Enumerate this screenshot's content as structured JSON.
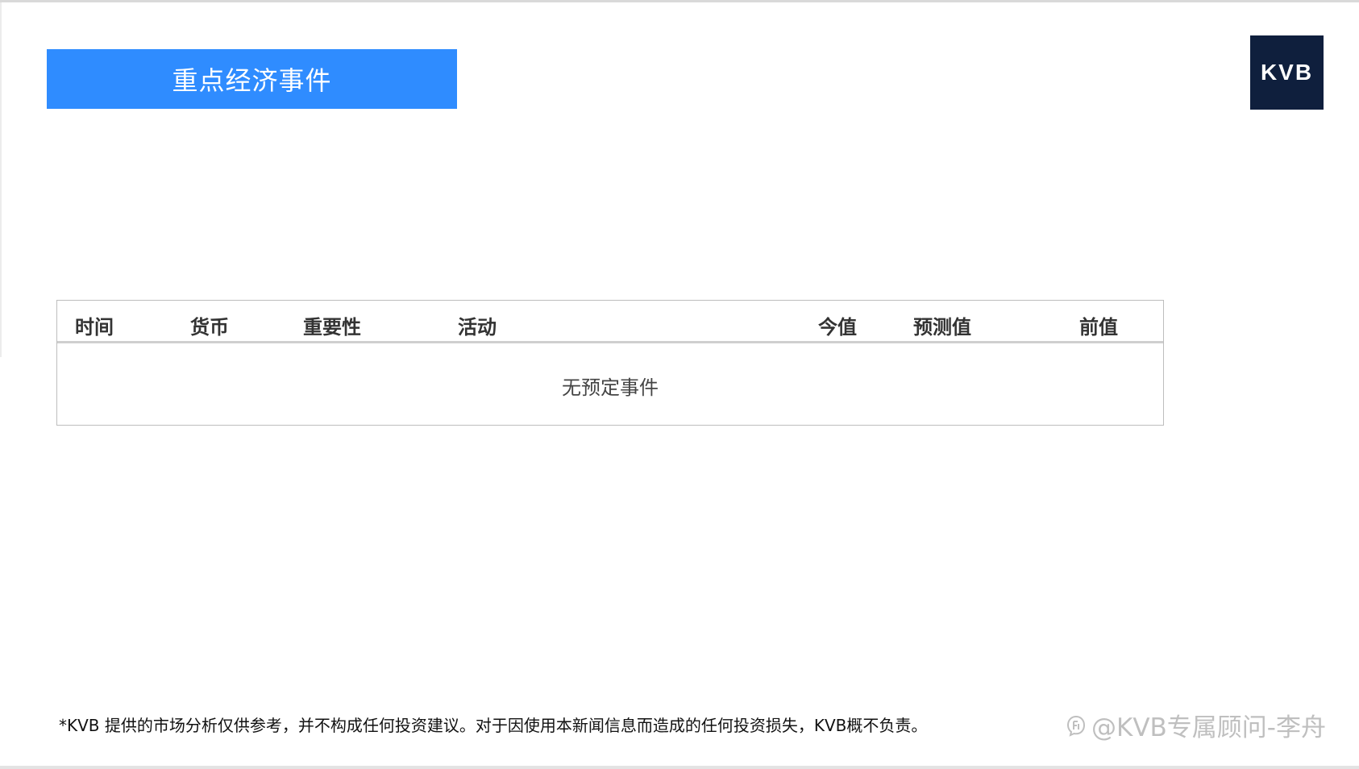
{
  "header": {
    "title": "重点经济事件",
    "logo_text": "KVB"
  },
  "table": {
    "columns": [
      "时间",
      "货币",
      "重要性",
      "活动",
      "今值",
      "预测值",
      "前值"
    ],
    "empty_message": "无预定事件"
  },
  "footer": {
    "disclaimer": "*KVB 提供的市场分析仅供参考，并不构成任何投资建议。对于因使用本新闻信息而造成的任何投资损失，KVB概不负责。",
    "watermark": "@KVB专属顾问-李舟",
    "watermark_icon": "zhihu-logo-icon"
  },
  "colors": {
    "banner": "#2f8cff",
    "logo_bg": "#0f1f3d"
  }
}
